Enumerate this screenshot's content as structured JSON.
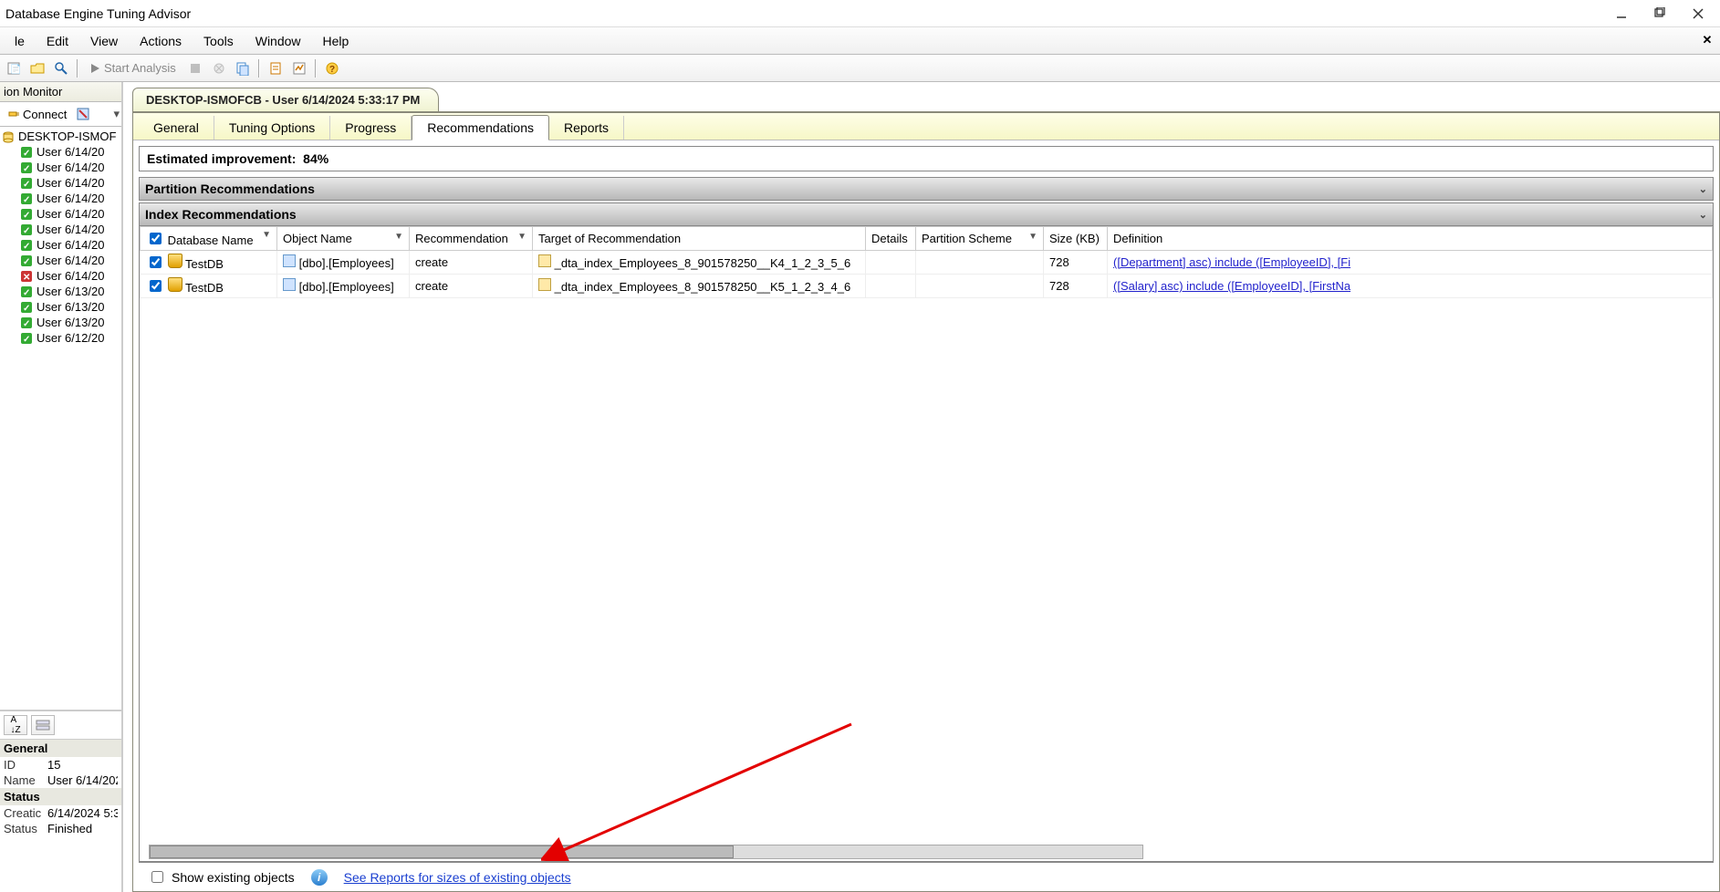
{
  "window": {
    "title": "Database Engine Tuning Advisor"
  },
  "menu": {
    "items": [
      "le",
      "Edit",
      "View",
      "Actions",
      "Tools",
      "Window",
      "Help"
    ]
  },
  "toolbar": {
    "start_label": "Start Analysis"
  },
  "session_monitor": {
    "title": "ion Monitor",
    "connect_label": "Connect",
    "server": "DESKTOP-ISMOF",
    "sessions": [
      "User 6/14/20",
      "User 6/14/20",
      "User 6/14/20",
      "User 6/14/20",
      "User 6/14/20",
      "User 6/14/20",
      "User 6/14/20",
      "User 6/14/20",
      "User 6/14/20",
      "User 6/13/20",
      "User 6/13/20",
      "User 6/13/20",
      "User 6/12/20"
    ]
  },
  "properties": {
    "group1": "General",
    "id_k": "ID",
    "id_v": "15",
    "name_k": "Name",
    "name_v": "User 6/14/202",
    "group2": "Status",
    "creat_k": "Creatic",
    "creat_v": "6/14/2024 5:3",
    "status_k": "Status",
    "status_v": "Finished"
  },
  "doc": {
    "tab_title": "DESKTOP-ISMOFCB - User 6/14/2024 5:33:17 PM"
  },
  "tabs": {
    "general": "General",
    "tuning": "Tuning Options",
    "progress": "Progress",
    "recs": "Recommendations",
    "reports": "Reports"
  },
  "improve": {
    "label": "Estimated improvement:",
    "value": "84%"
  },
  "sections": {
    "partition": "Partition Recommendations",
    "index": "Index Recommendations"
  },
  "cols": {
    "dbname": "Database Name",
    "objname": "Object Name",
    "rec": "Recommendation",
    "target": "Target of Recommendation",
    "details": "Details",
    "pscheme": "Partition Scheme",
    "size": "Size (KB)",
    "def": "Definition"
  },
  "rows": [
    {
      "db": "TestDB",
      "obj": "[dbo].[Employees]",
      "rec": "create",
      "target": "_dta_index_Employees_8_901578250__K4_1_2_3_5_6",
      "details": "",
      "pscheme": "",
      "size": "728",
      "def": "([Department] asc) include ([EmployeeID], [Fi"
    },
    {
      "db": "TestDB",
      "obj": "[dbo].[Employees]",
      "rec": "create",
      "target": "_dta_index_Employees_8_901578250__K5_1_2_3_4_6",
      "details": "",
      "pscheme": "",
      "size": "728",
      "def": "([Salary] asc) include ([EmployeeID], [FirstNa"
    }
  ],
  "bottom": {
    "show_existing": "Show existing objects",
    "see_reports": "See Reports for sizes of existing objects"
  }
}
